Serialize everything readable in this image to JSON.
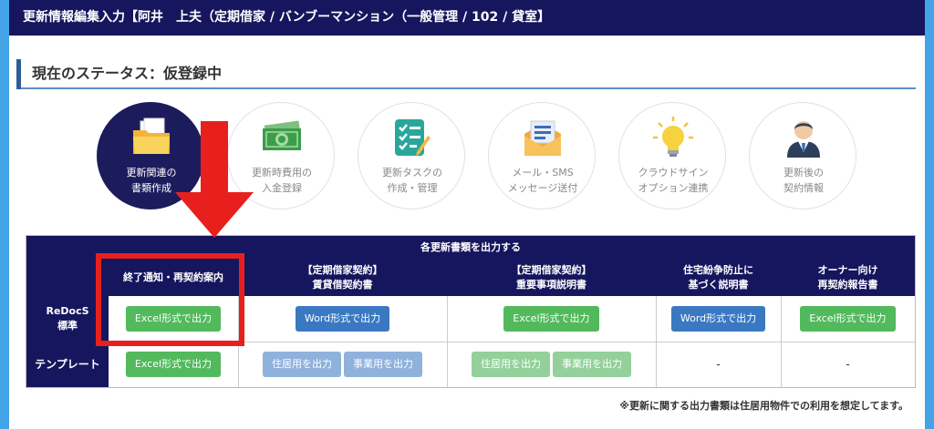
{
  "window": {
    "title": "更新情報編集入力【阿井　上夫（定期借家 / バンブーマンション（一般管理 / 102 / 貸室】"
  },
  "status": {
    "text": "現在のステータス：仮登録中"
  },
  "steps": [
    {
      "label": "更新関連の\n書類作成",
      "icon": "folder-icon",
      "active": true
    },
    {
      "label": "更新時費用の\n入金登録",
      "icon": "banknote-icon",
      "active": false
    },
    {
      "label": "更新タスクの\n作成・管理",
      "icon": "checklist-icon",
      "active": false
    },
    {
      "label": "メール・SMS\nメッセージ送付",
      "icon": "envelope-icon",
      "active": false
    },
    {
      "label": "クラウドサイン\nオプション連携",
      "icon": "lightbulb-icon",
      "active": false
    },
    {
      "label": "更新後の\n契約情報",
      "icon": "businessman-icon",
      "active": false
    }
  ],
  "table": {
    "title": "各更新書類を出力する",
    "columns": [
      "終了通知・再契約案内",
      "【定期借家契約】\n賃貸借契約書",
      "【定期借家契約】\n重要事項説明書",
      "住宅紛争防止に\n基づく説明書",
      "オーナー向け\n再契約報告書"
    ],
    "rows": [
      {
        "label": "ReDocS\n標準",
        "buttons": [
          "Excel形式で出力",
          "Word形式で出力",
          "Excel形式で出力",
          "Word形式で出力",
          "Excel形式で出力"
        ]
      },
      {
        "label": "テンプレート",
        "excel": "Excel形式で出力",
        "lease_residential": "住居用を出力",
        "lease_business": "事業用を出力",
        "important_residential": "住居用を出力",
        "important_business": "事業用を出力",
        "dispute": "-",
        "owner": "-"
      }
    ]
  },
  "footnote": "※更新に関する出力書類は住居用物件での利用を想定してます。",
  "colors": {
    "header_navy": "#16165e",
    "excel_green": "#52b95d",
    "word_blue": "#3a79c2",
    "highlight_red": "#e8201d",
    "page_background": "#45a4e8"
  }
}
